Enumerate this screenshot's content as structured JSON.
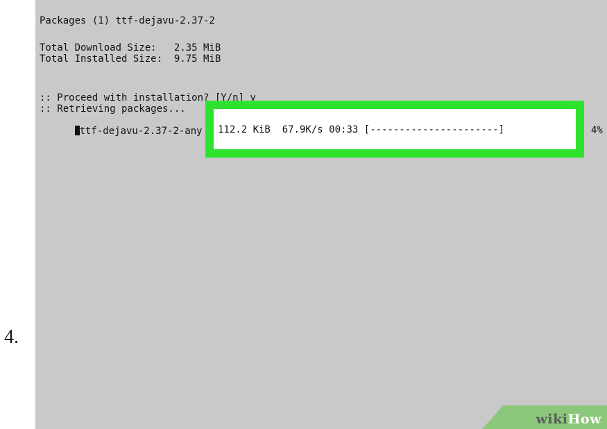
{
  "step_number": "4.",
  "terminal": {
    "lines": {
      "packages": "Packages (1) ttf-dejavu-2.37-2",
      "download_size": "Total Download Size:   2.35 MiB",
      "installed_size": "Total Installed Size:  9.75 MiB",
      "proceed": ":: Proceed with installation? [Y/n] y",
      "retrieving": ":: Retrieving packages...",
      "package_name": "ttf-dejavu-2.37-2-any"
    },
    "progress": {
      "transferred": "112.2 KiB",
      "speed": "67.9K/s",
      "eta": "00:33",
      "bar": "[----------------------]",
      "percent_label": "4%",
      "percent_value": 4
    }
  },
  "highlight": {
    "color": "#2ee22e"
  },
  "watermark": {
    "part1": "wiki",
    "part2": "How",
    "band_color": "#8cc87c"
  },
  "colors": {
    "terminal_bg": "#c9c9c9",
    "terminal_text": "#111111"
  }
}
